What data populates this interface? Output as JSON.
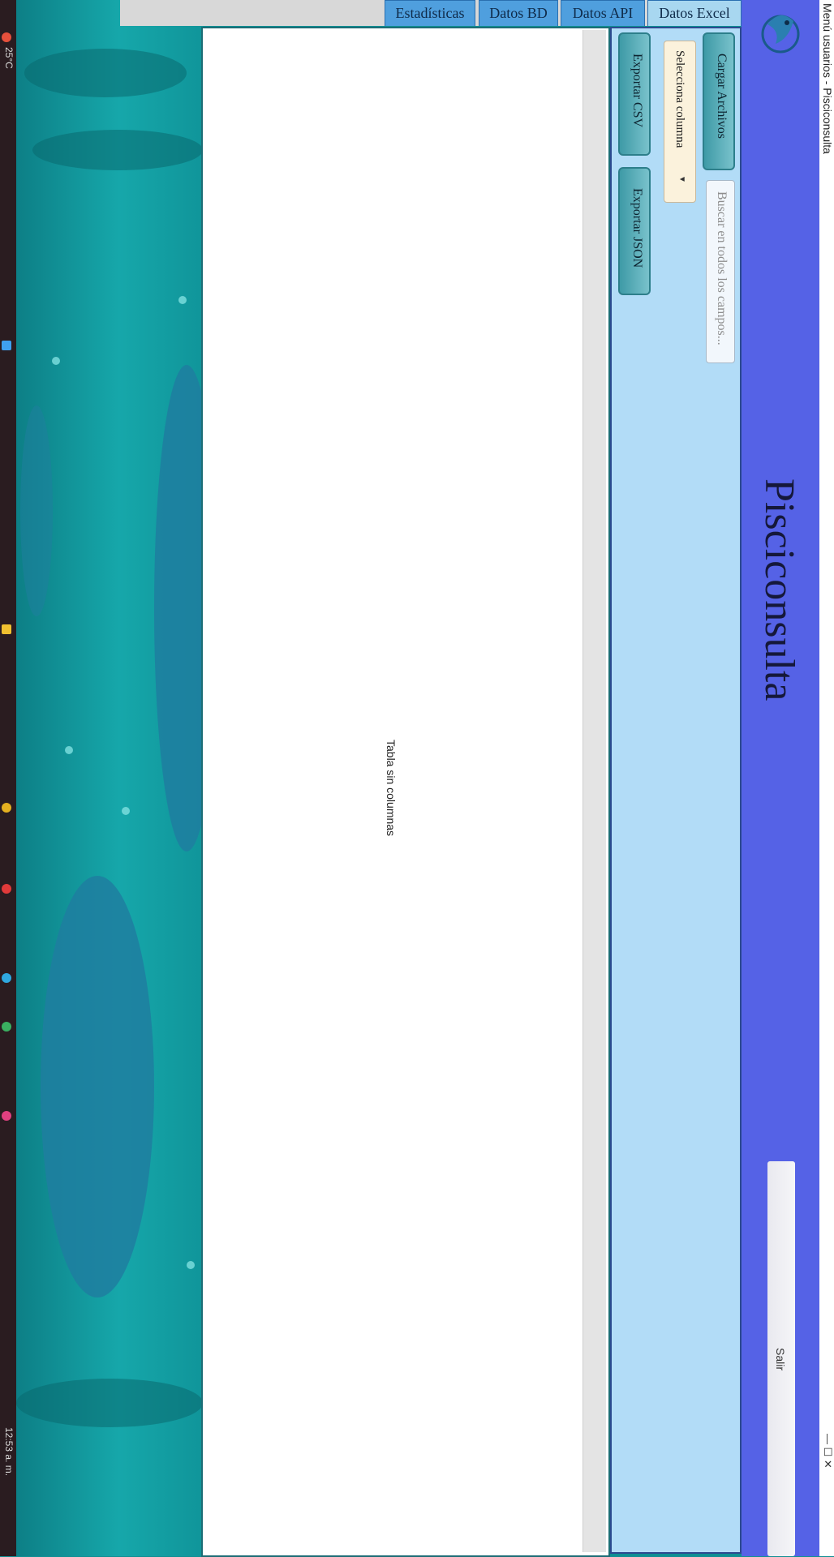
{
  "taskbar": {
    "temperature": "25°C",
    "clock": "12:53 a. m."
  },
  "window": {
    "title": "Menú usuarios - Pisciconsulta",
    "controls": "—  ☐  ✕"
  },
  "header": {
    "app_title": "Pisciconsulta",
    "logo_icon": "fish-logo-icon",
    "exit_label": "Salir"
  },
  "tabs": [
    {
      "label": "Estadísticas",
      "active": false
    },
    {
      "label": "Datos BD",
      "active": false
    },
    {
      "label": "Datos API",
      "active": false
    },
    {
      "label": "Datos Excel",
      "active": true
    }
  ],
  "toolbar": {
    "load_files_label": "Cargar Archivos",
    "search_placeholder": "Buscar en todos los campos...",
    "column_select_label": "Selecciona columna",
    "export_csv_label": "Exportar CSV",
    "export_json_label": "Exportar JSON"
  },
  "table": {
    "empty_message": "Tabla sin columnas"
  },
  "colors": {
    "header_bg": "#5562e6",
    "panel_bg": "#b2dcf7",
    "tab_bg": "#4f9fde",
    "button_accent": "#3e9aa6"
  }
}
